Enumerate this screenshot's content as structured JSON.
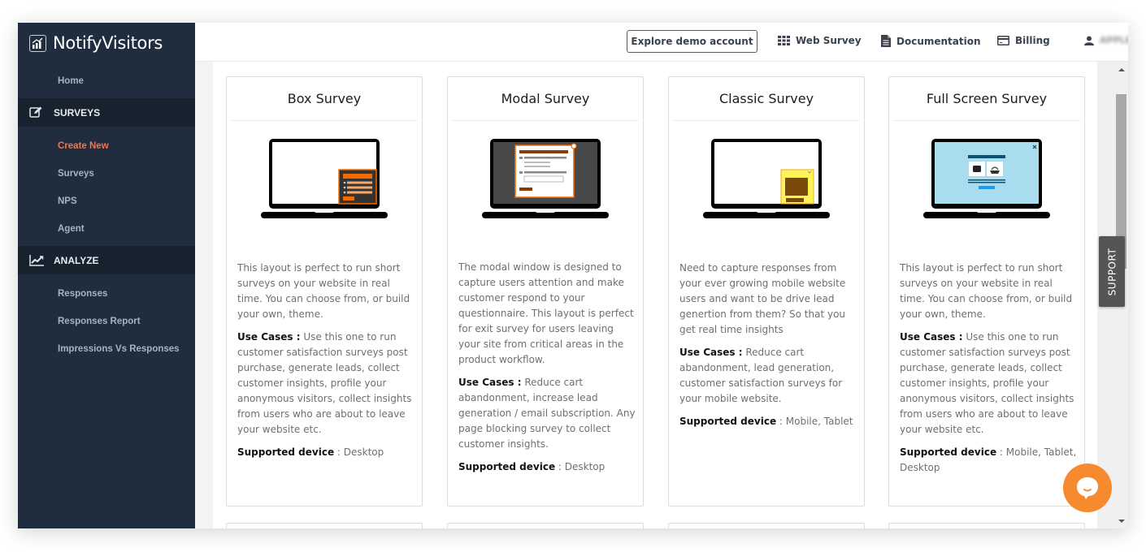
{
  "app": {
    "brand": "NotifyVisitors"
  },
  "sidebar": {
    "home": "Home",
    "sections": [
      {
        "label": "SURVEYS",
        "icon": "edit-icon",
        "items": [
          "Create New",
          "Surveys",
          "NPS",
          "Agent"
        ],
        "active": "Create New"
      },
      {
        "label": "ANALYZE",
        "icon": "line-chart-icon",
        "items": [
          "Responses",
          "Responses Report",
          "Impressions Vs Responses"
        ]
      }
    ]
  },
  "header": {
    "demo_button": "Explore demo account",
    "links": [
      {
        "label": "Web Survey",
        "icon": "grid-icon"
      },
      {
        "label": "Documentation",
        "icon": "document-icon"
      },
      {
        "label": "Billing",
        "icon": "credit-card-icon"
      }
    ],
    "user": {
      "icon": "user-icon",
      "name": "APPLE"
    }
  },
  "cards": [
    {
      "title": "Box Survey",
      "description": "This layout is perfect to run short surveys on your website in real time. You can choose from, or build your own, theme.",
      "use_cases_label": "Use Cases :",
      "use_cases": "Use this one to run customer satisfaction surveys post purchase, generate leads, collect customer insights, profile your anonymous visitors, collect insights from users who are about to leave your website etc.",
      "device_label": "Supported device",
      "devices": "Desktop"
    },
    {
      "title": "Modal Survey",
      "description": "The modal window is designed to capture users attention and make customer respond to your questionnaire. This layout is perfect for exit survey for users leaving your site from critical areas in the product workflow.",
      "use_cases_label": "Use Cases :",
      "use_cases": "Reduce cart abandonment, increase lead generation / email subscription. Any page blocking survey to collect customer insights.",
      "device_label": "Supported device",
      "devices": "Desktop"
    },
    {
      "title": "Classic Survey",
      "description": "Need to capture responses from your ever growing mobile website users and want to be drive lead genertion from them? So that you get real time insights",
      "use_cases_label": "Use Cases :",
      "use_cases": "Reduce cart abandonment, lead generation, customer satisfaction surveys for your mobile website.",
      "device_label": "Supported device",
      "devices": "Mobile, Tablet"
    },
    {
      "title": "Full Screen Survey",
      "description": "This layout is perfect to run short surveys on your website in real time. You can choose from, or build your own, theme.",
      "use_cases_label": "Use Cases :",
      "use_cases": "Use this one to run customer satisfaction surveys post purchase, generate leads, collect customer insights, profile your anonymous visitors, collect insights from users who are about to leave your website etc.",
      "device_label": "Supported device",
      "devices": "Mobile, Tablet, Desktop"
    }
  ],
  "support_tab": "SUPPORT",
  "colors": {
    "sidebar": "#1f2d3e",
    "active": "#f4764b",
    "chat": "#f78a2f"
  }
}
